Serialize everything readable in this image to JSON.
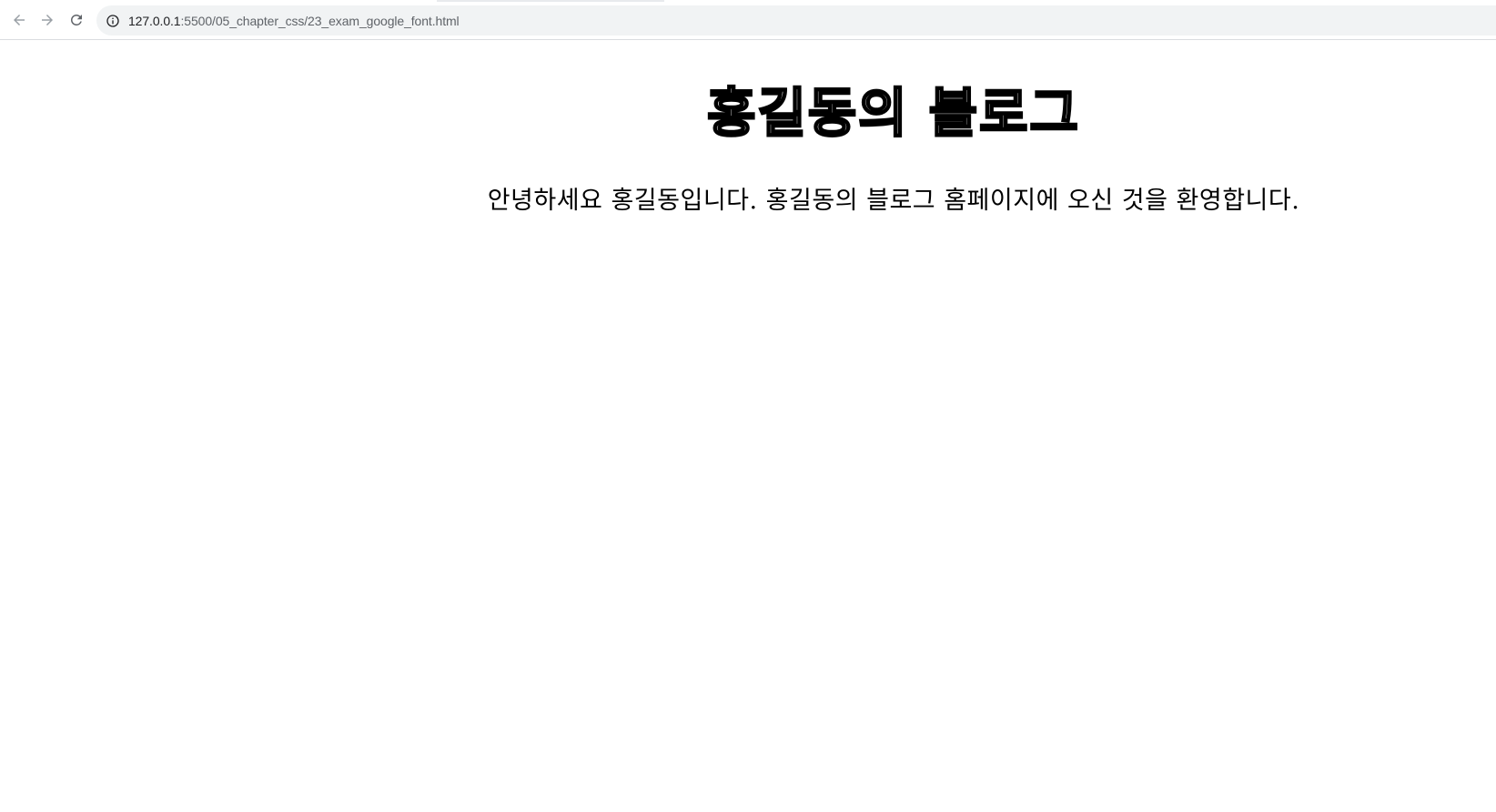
{
  "browser": {
    "url_host": "127.0.0.1",
    "url_path": ":5500/05_chapter_css/23_exam_google_font.html",
    "icons": {
      "back": "arrow-left-icon",
      "forward": "arrow-right-icon",
      "reload": "reload-icon",
      "site_info": "info-icon"
    }
  },
  "page": {
    "title": "홍길동의 블로그",
    "intro": "안녕하세요 홍길동입니다. 홍길동의 블로그 홈페이지에 오신 것을 환영합니다."
  },
  "colors": {
    "toolbar_bg": "#ffffff",
    "omnibox_bg": "#f1f3f4",
    "icon_gray": "#5f6368",
    "text": "#000000"
  }
}
